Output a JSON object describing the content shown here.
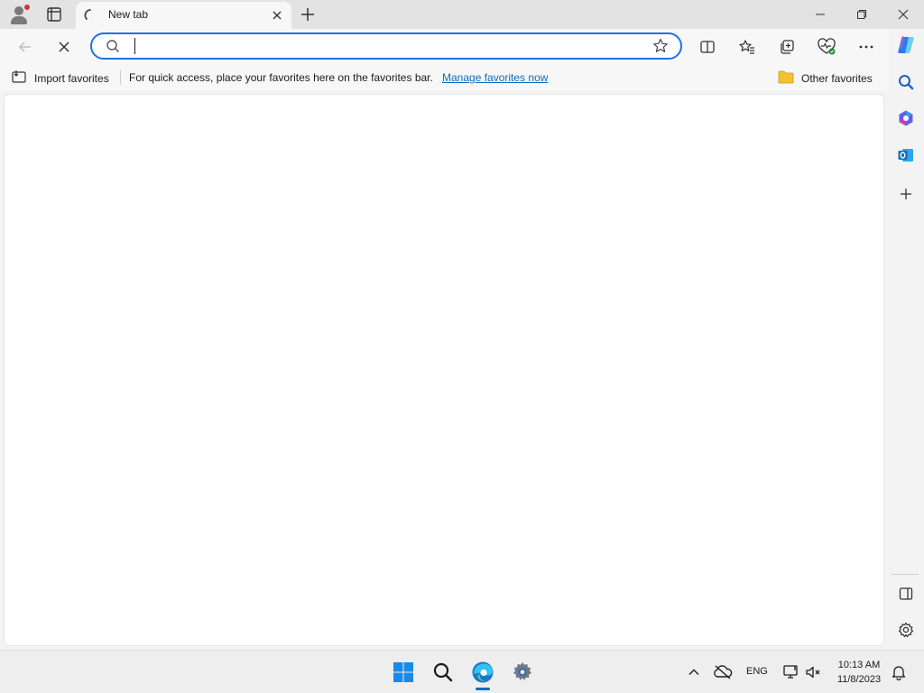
{
  "tab": {
    "title": "New tab"
  },
  "address": {
    "value": "",
    "placeholder": ""
  },
  "favorites_bar": {
    "import_label": "Import favorites",
    "message": "For quick access, place your favorites here on the favorites bar.",
    "manage_link": "Manage favorites now",
    "other_label": "Other favorites"
  },
  "taskbar": {
    "language": "ENG",
    "time": "10:13 AM",
    "date": "11/8/2023"
  },
  "colors": {
    "accent": "#0f6cbd",
    "address_border": "#1a73e8",
    "notification_dot": "#d13438"
  },
  "icons": [
    "profile-icon",
    "tab-actions-icon",
    "loading-icon",
    "close-icon",
    "new-tab-icon",
    "minimize-icon",
    "restore-icon",
    "window-close-icon",
    "back-icon",
    "stop-icon",
    "search-icon",
    "favorite-star-icon",
    "split-screen-icon",
    "favorites-icon",
    "collections-icon",
    "browser-essentials-icon",
    "more-icon",
    "copilot-icon",
    "import-icon",
    "folder-icon",
    "sidebar-search-icon",
    "microsoft365-icon",
    "outlook-icon",
    "add-icon",
    "hide-sidebar-icon",
    "settings-icon",
    "windows-start-icon",
    "taskbar-search-icon",
    "edge-icon",
    "taskbar-settings-icon",
    "chevron-up-icon",
    "onedrive-icon",
    "network-icon",
    "volume-icon",
    "notification-bell-icon"
  ]
}
